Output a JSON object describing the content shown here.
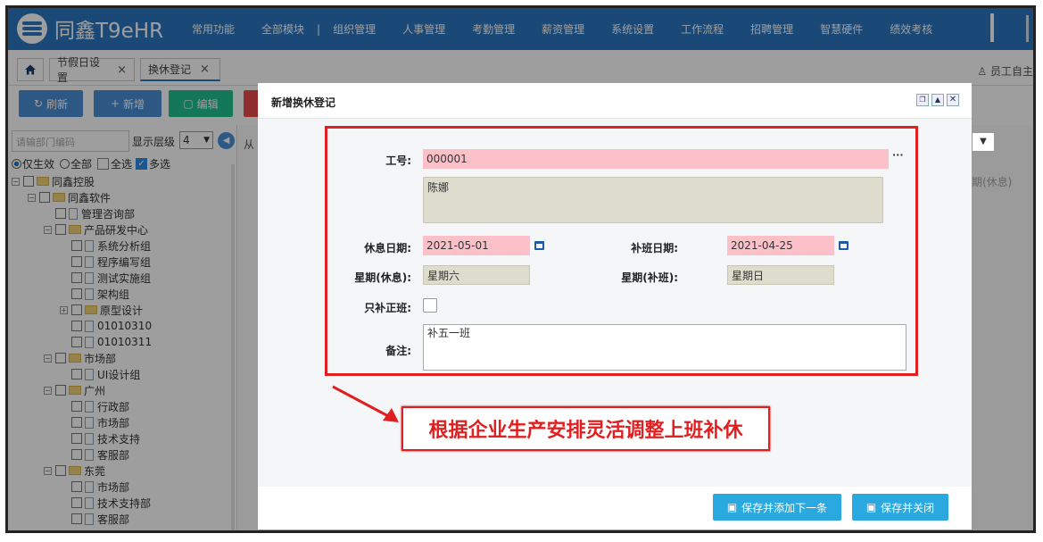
{
  "app": {
    "title": "同鑫T9eHR"
  },
  "menu": [
    "常用功能",
    "全部模块",
    "组织管理",
    "人事管理",
    "考勤管理",
    "薪资管理",
    "系统设置",
    "工作流程",
    "招聘管理",
    "智慧硬件",
    "绩效考核"
  ],
  "menu_separator": "|",
  "tabs": [
    {
      "label": "节假日设置",
      "close": "×"
    },
    {
      "label": "换休登记",
      "close": "×"
    }
  ],
  "home_icon": "home-icon",
  "self_service": "员工自主",
  "toolbar": {
    "refresh": "刷新",
    "add": "新增",
    "edit": "编辑"
  },
  "left": {
    "dept_placeholder": "请输部门编码",
    "level_label": "显示层级",
    "level_value": "4",
    "opt_effective": "仅生效",
    "opt_all": "全部",
    "opt_select_all": "全选",
    "opt_multi": "多选"
  },
  "tree": [
    {
      "label": "同鑫控股",
      "level": 0,
      "type": "folder",
      "toggle": "⊟"
    },
    {
      "label": "同鑫软件",
      "level": 1,
      "type": "folder",
      "toggle": "⊟"
    },
    {
      "label": "管理咨询部",
      "level": 2,
      "type": "file",
      "toggle": ""
    },
    {
      "label": "产品研发中心",
      "level": 2,
      "type": "folder",
      "toggle": "⊟"
    },
    {
      "label": "系统分析组",
      "level": 3,
      "type": "file",
      "toggle": ""
    },
    {
      "label": "程序编写组",
      "level": 3,
      "type": "file",
      "toggle": ""
    },
    {
      "label": "测试实施组",
      "level": 3,
      "type": "file",
      "toggle": ""
    },
    {
      "label": "架构组",
      "level": 3,
      "type": "file",
      "toggle": ""
    },
    {
      "label": "原型设计",
      "level": 3,
      "type": "folder",
      "toggle": "⊞"
    },
    {
      "label": "01010310",
      "level": 3,
      "type": "file",
      "toggle": ""
    },
    {
      "label": "01010311",
      "level": 3,
      "type": "file",
      "toggle": ""
    },
    {
      "label": "市场部",
      "level": 2,
      "type": "folder",
      "toggle": "⊟"
    },
    {
      "label": "UI设计组",
      "level": 3,
      "type": "file",
      "toggle": ""
    },
    {
      "label": "广州",
      "level": 2,
      "type": "folder",
      "toggle": "⊟"
    },
    {
      "label": "行政部",
      "level": 3,
      "type": "file",
      "toggle": ""
    },
    {
      "label": "市场部",
      "level": 3,
      "type": "file",
      "toggle": ""
    },
    {
      "label": "技术支持",
      "level": 3,
      "type": "file",
      "toggle": ""
    },
    {
      "label": "客服部",
      "level": 3,
      "type": "file",
      "toggle": ""
    },
    {
      "label": "东莞",
      "level": 2,
      "type": "folder",
      "toggle": "⊟"
    },
    {
      "label": "市场部",
      "level": 3,
      "type": "file",
      "toggle": ""
    },
    {
      "label": "技术支持部",
      "level": 3,
      "type": "file",
      "toggle": ""
    },
    {
      "label": "客服部",
      "level": 3,
      "type": "file",
      "toggle": ""
    }
  ],
  "behind": {
    "corner_text": "从",
    "column_header": "期(休息)"
  },
  "modal": {
    "title": "新增换休登记",
    "emp_no_label": "工号:",
    "emp_no_value": "000001",
    "emp_lookup": "···",
    "emp_name": "陈娜",
    "rest_date_label": "休息日期:",
    "rest_date_value": "2021-05-01",
    "make_up_date_label": "补班日期:",
    "make_up_date_value": "2021-04-25",
    "rest_weekday_label": "星期(休息):",
    "rest_weekday_value": "星期六",
    "make_up_weekday_label": "星期(补班):",
    "make_up_weekday_value": "星期日",
    "only_regular_label": "只补正班:",
    "remark_label": "备注:",
    "remark_value": "补五一班",
    "save_add_next": "保存并添加下一条",
    "save_close": "保存并关闭"
  },
  "annotation": "根据企业生产安排灵活调整上班补休",
  "colors": {
    "header_blue": "#2c77c0",
    "annotation_red": "#e02020",
    "save_button": "#29a9e0",
    "edit_green": "#1fc08e"
  }
}
